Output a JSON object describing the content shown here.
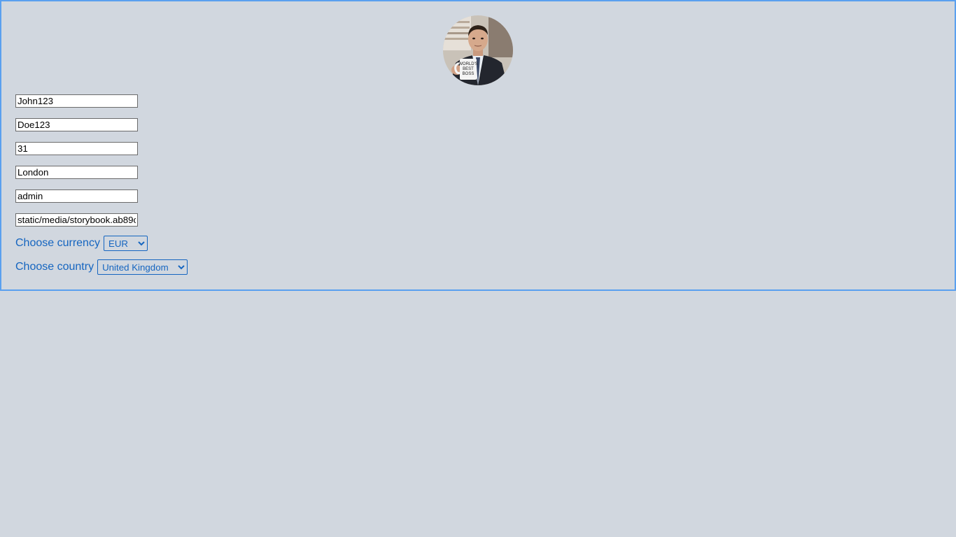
{
  "profile": {
    "avatar_icon": "profile-photo-worlds-best-boss-mug",
    "mug_text": [
      "WORLD'S",
      "BEST",
      "BOSS"
    ]
  },
  "fields": {
    "first_name": "John123",
    "last_name": "Doe123",
    "age": "31",
    "city": "London",
    "role": "admin",
    "image_path": "static/media/storybook.ab89c"
  },
  "currency": {
    "label": "Choose currency",
    "selected": "EUR"
  },
  "country": {
    "label": "Choose country",
    "selected": "United Kingdom"
  },
  "colors": {
    "background": "#d1d7df",
    "border_accent": "#5aa0ef",
    "label_text": "#1565c0"
  }
}
